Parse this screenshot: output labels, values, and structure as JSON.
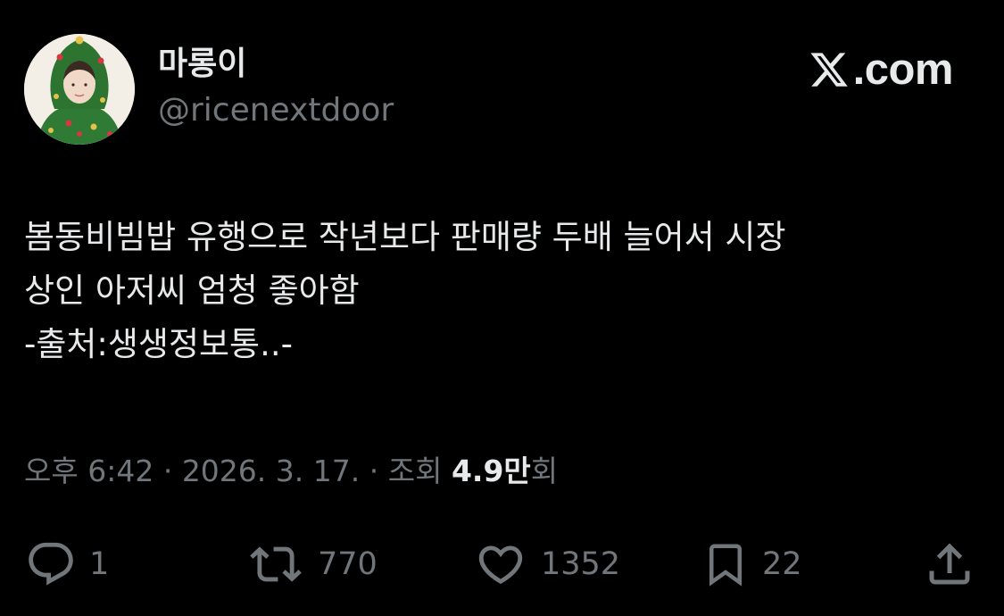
{
  "author": {
    "display_name": "마롱이",
    "handle": "@ricenextdoor"
  },
  "brand": {
    "label": ".com",
    "logo_icon": "x-logo-icon"
  },
  "tweet": {
    "lines": [
      "봄동비빔밥 유행으로 작년보다 판매량 두배 늘어서 시장",
      "상인 아저씨 엄청 좋아함",
      "-출처:생생정보통..-"
    ]
  },
  "meta": {
    "time": "오후 6:42",
    "separator": " · ",
    "date": "2026. 3. 17.",
    "views_label": "조회",
    "views_count": "4.9만",
    "views_suffix": "회"
  },
  "actions": {
    "reply": "1",
    "retweet": "770",
    "like": "1352",
    "bookmark": "22"
  },
  "colors": {
    "background": "#000000",
    "text_primary": "#e7e9ea",
    "text_secondary": "#71767b"
  }
}
